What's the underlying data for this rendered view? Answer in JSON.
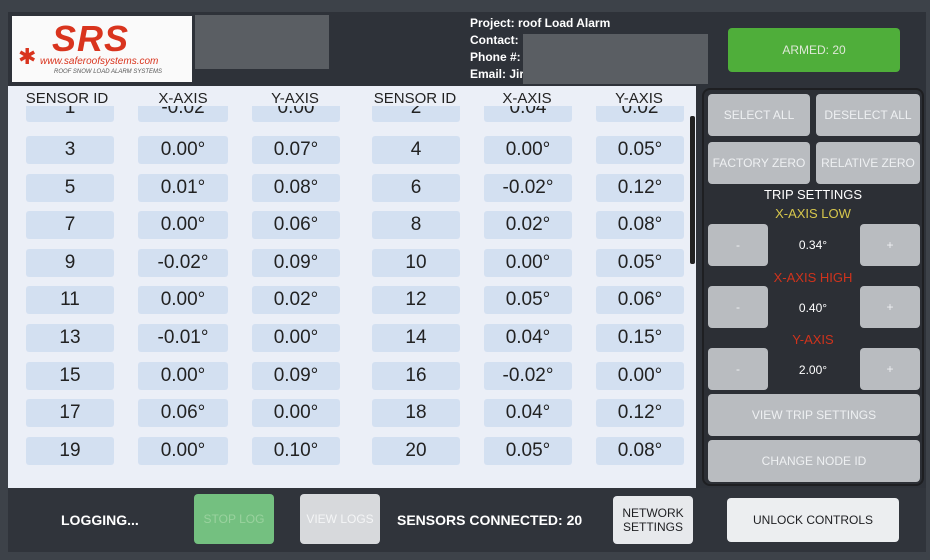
{
  "header": {
    "logo_text": "SRS",
    "logo_url": "www.saferoofsystems.com",
    "logo_tagline": "ROOF SNOW LOAD ALARM SYSTEMS",
    "project": "Project: roof Load Alarm",
    "contact": "Contact:",
    "phone": "Phone #:",
    "email": "Email: Jir",
    "armed": "ARMED: 20"
  },
  "table": {
    "headers": [
      "SENSOR ID",
      "X-AXIS",
      "Y-AXIS",
      "SENSOR ID",
      "X-AXIS",
      "Y-AXIS"
    ],
    "partial_row": [
      "1",
      "-0.02",
      "0.00",
      "2",
      "0.04",
      "0.02"
    ],
    "rows": [
      [
        "3",
        "0.00°",
        "0.07°",
        "4",
        "0.00°",
        "0.05°"
      ],
      [
        "5",
        "0.01°",
        "0.08°",
        "6",
        "-0.02°",
        "0.12°"
      ],
      [
        "7",
        "0.00°",
        "0.06°",
        "8",
        "0.02°",
        "0.08°"
      ],
      [
        "9",
        "-0.02°",
        "0.09°",
        "10",
        "0.00°",
        "0.05°"
      ],
      [
        "11",
        "0.00°",
        "0.02°",
        "12",
        "0.05°",
        "0.06°"
      ],
      [
        "13",
        "-0.01°",
        "0.00°",
        "14",
        "0.04°",
        "0.15°"
      ],
      [
        "15",
        "0.00°",
        "0.09°",
        "16",
        "-0.02°",
        "0.00°"
      ],
      [
        "17",
        "0.06°",
        "0.00°",
        "18",
        "0.04°",
        "0.12°"
      ],
      [
        "19",
        "0.00°",
        "0.10°",
        "20",
        "0.05°",
        "0.08°"
      ]
    ]
  },
  "controls": {
    "select_all": "SELECT ALL",
    "deselect_all": "DESELECT ALL",
    "factory_zero": "FACTORY ZERO",
    "relative_zero": "RELATIVE ZERO",
    "trip_settings": "TRIP SETTINGS",
    "x_axis_low_label": "X-AXIS LOW",
    "x_axis_low_value": "0.34°",
    "x_axis_high_label": "X-AXIS HIGH",
    "x_axis_high_value": "0.40°",
    "y_axis_label": "Y-AXIS",
    "y_axis_value": "2.00°",
    "minus": "-",
    "plus": "+",
    "view_trip_settings": "VIEW TRIP SETTINGS",
    "change_node_id": "CHANGE NODE ID"
  },
  "footer": {
    "logging": "LOGGING...",
    "stop_log": "STOP LOG",
    "view_logs": "VIEW LOGS",
    "sensors_connected": "SENSORS CONNECTED: 20",
    "network_settings": "NETWORK SETTINGS",
    "unlock_controls": "UNLOCK CONTROLS"
  },
  "colors": {
    "armed_green": "#4fae3a",
    "cell_blue": "#d3e0f1",
    "label_yellow": "#d6c64c",
    "label_red": "#d0331c"
  }
}
